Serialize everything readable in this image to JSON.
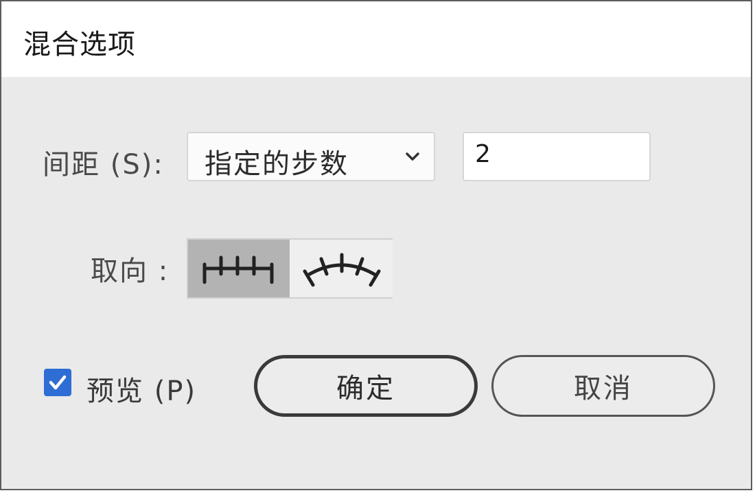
{
  "dialog": {
    "title": "混合选项"
  },
  "spacing": {
    "label": "间距 (S):",
    "selected_option": "指定的步数",
    "value": "2"
  },
  "orientation": {
    "label": "取向 :",
    "options": [
      {
        "icon": "align-to-page-icon",
        "selected": true
      },
      {
        "icon": "align-to-path-icon",
        "selected": false
      }
    ]
  },
  "preview": {
    "label": "预览 (P)",
    "checked": true
  },
  "buttons": {
    "ok_label": "确定",
    "cancel_label": "取消"
  },
  "colors": {
    "accent": "#2e6ed4",
    "dialog_background": "#eaeaea",
    "selected_segment": "#b3b3b3"
  }
}
